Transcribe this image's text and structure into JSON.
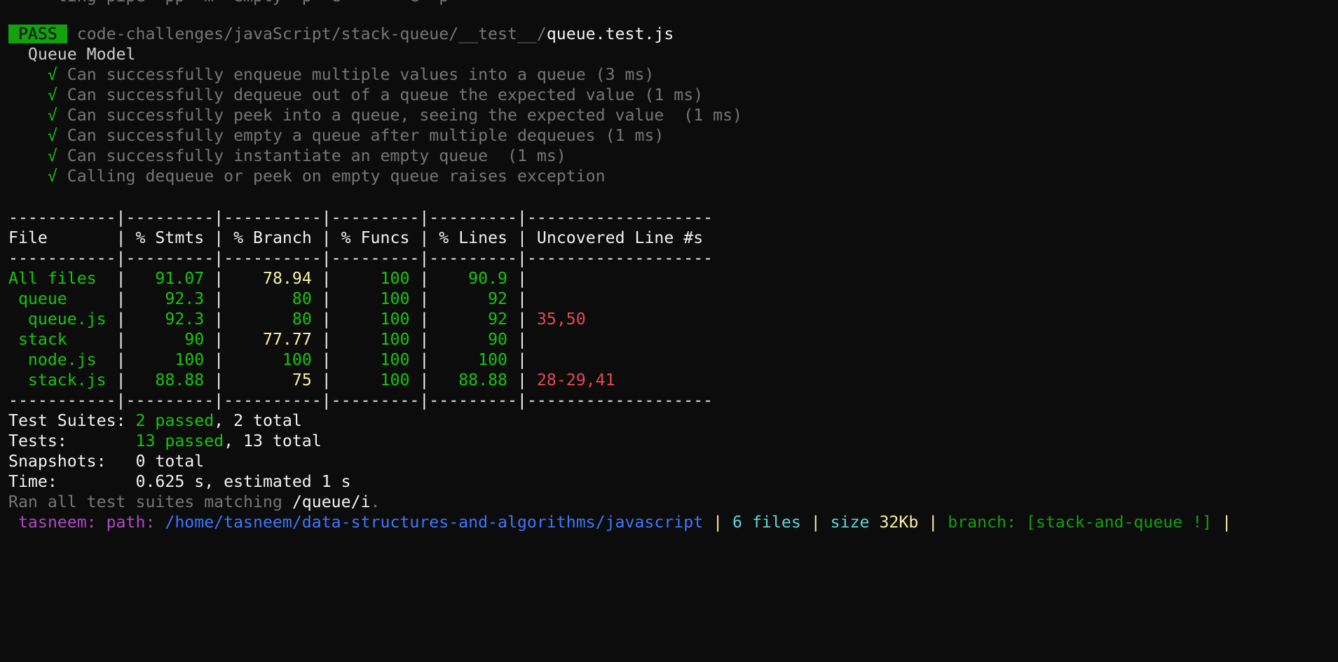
{
  "top_partial": "   ✓ ting pipe  pp  m  empty  p  e       e  p",
  "suite": {
    "badge": " PASS ",
    "path_prefix": "code-challenges/javaScript/stack-queue/__test__/",
    "path_file": "queue.test.js",
    "describe": "  Queue Model",
    "tests": [
      {
        "check": "√",
        "text": "Can successfully enqueue multiple values into a queue (3 ms)"
      },
      {
        "check": "√",
        "text": "Can successfully dequeue out of a queue the expected value (1 ms)"
      },
      {
        "check": "√",
        "text": "Can successfully peek into a queue, seeing the expected value  (1 ms)"
      },
      {
        "check": "√",
        "text": "Can successfully empty a queue after multiple dequeues (1 ms)"
      },
      {
        "check": "√",
        "text": "Can successfully instantiate an empty queue  (1 ms)"
      },
      {
        "check": "√",
        "text": "Calling dequeue or peek on empty queue raises exception"
      }
    ]
  },
  "coverage": {
    "separator": "-----------|---------|----------|---------|---------|-------------------",
    "header": {
      "file": "File       ",
      "stmts": " % Stmts ",
      "branch": " % Branch ",
      "funcs": " % Funcs ",
      "lines": " % Lines ",
      "uncovered": " Uncovered Line #s "
    },
    "rows": [
      {
        "file": "All files  ",
        "stmts": "   91.07 ",
        "branch": "    78.94 ",
        "funcs": "     100 ",
        "lines": "    90.9 ",
        "uncovered": "",
        "branch_color": "yellow"
      },
      {
        "file": " queue     ",
        "stmts": "    92.3 ",
        "branch": "       80 ",
        "funcs": "     100 ",
        "lines": "      92 ",
        "uncovered": "",
        "branch_color": "green"
      },
      {
        "file": "  queue.js ",
        "stmts": "    92.3 ",
        "branch": "       80 ",
        "funcs": "     100 ",
        "lines": "      92 ",
        "uncovered": " 35,50",
        "branch_color": "green"
      },
      {
        "file": " stack     ",
        "stmts": "      90 ",
        "branch": "    77.77 ",
        "funcs": "     100 ",
        "lines": "      90 ",
        "uncovered": "",
        "branch_color": "yellow"
      },
      {
        "file": "  node.js  ",
        "stmts": "     100 ",
        "branch": "      100 ",
        "funcs": "     100 ",
        "lines": "     100 ",
        "uncovered": "",
        "branch_color": "green"
      },
      {
        "file": "  stack.js ",
        "stmts": "   88.88 ",
        "branch": "       75 ",
        "funcs": "     100 ",
        "lines": "   88.88 ",
        "uncovered": " 28-29,41",
        "branch_color": "yellow"
      }
    ]
  },
  "summary": {
    "suites_label": "Test Suites: ",
    "suites_passed": "2 passed",
    "suites_total": ", 2 total",
    "tests_label": "Tests:       ",
    "tests_passed": "13 passed",
    "tests_total": ", 13 total",
    "snapshots_label": "Snapshots:   ",
    "snapshots_value": "0 total",
    "time_label": "Time:        ",
    "time_value": "0.625 s, estimated 1 s",
    "ran_prefix": "Ran all test suites matching ",
    "ran_pattern": "/queue/i",
    "ran_suffix": "."
  },
  "prompt": {
    "user": " tasneem:",
    "path_label": " path:",
    "path_value": " /home/tasneem/data-structures-and-algorithms/javascript",
    "sep1": " |",
    "files": " 6 files",
    "sep2": " |",
    "size_label": " size",
    "size_value": " 32Kb",
    "sep3": " |",
    "branch_label": " branch:",
    "branch_value": " [stack-and-queue !]",
    "sep4": " |"
  }
}
